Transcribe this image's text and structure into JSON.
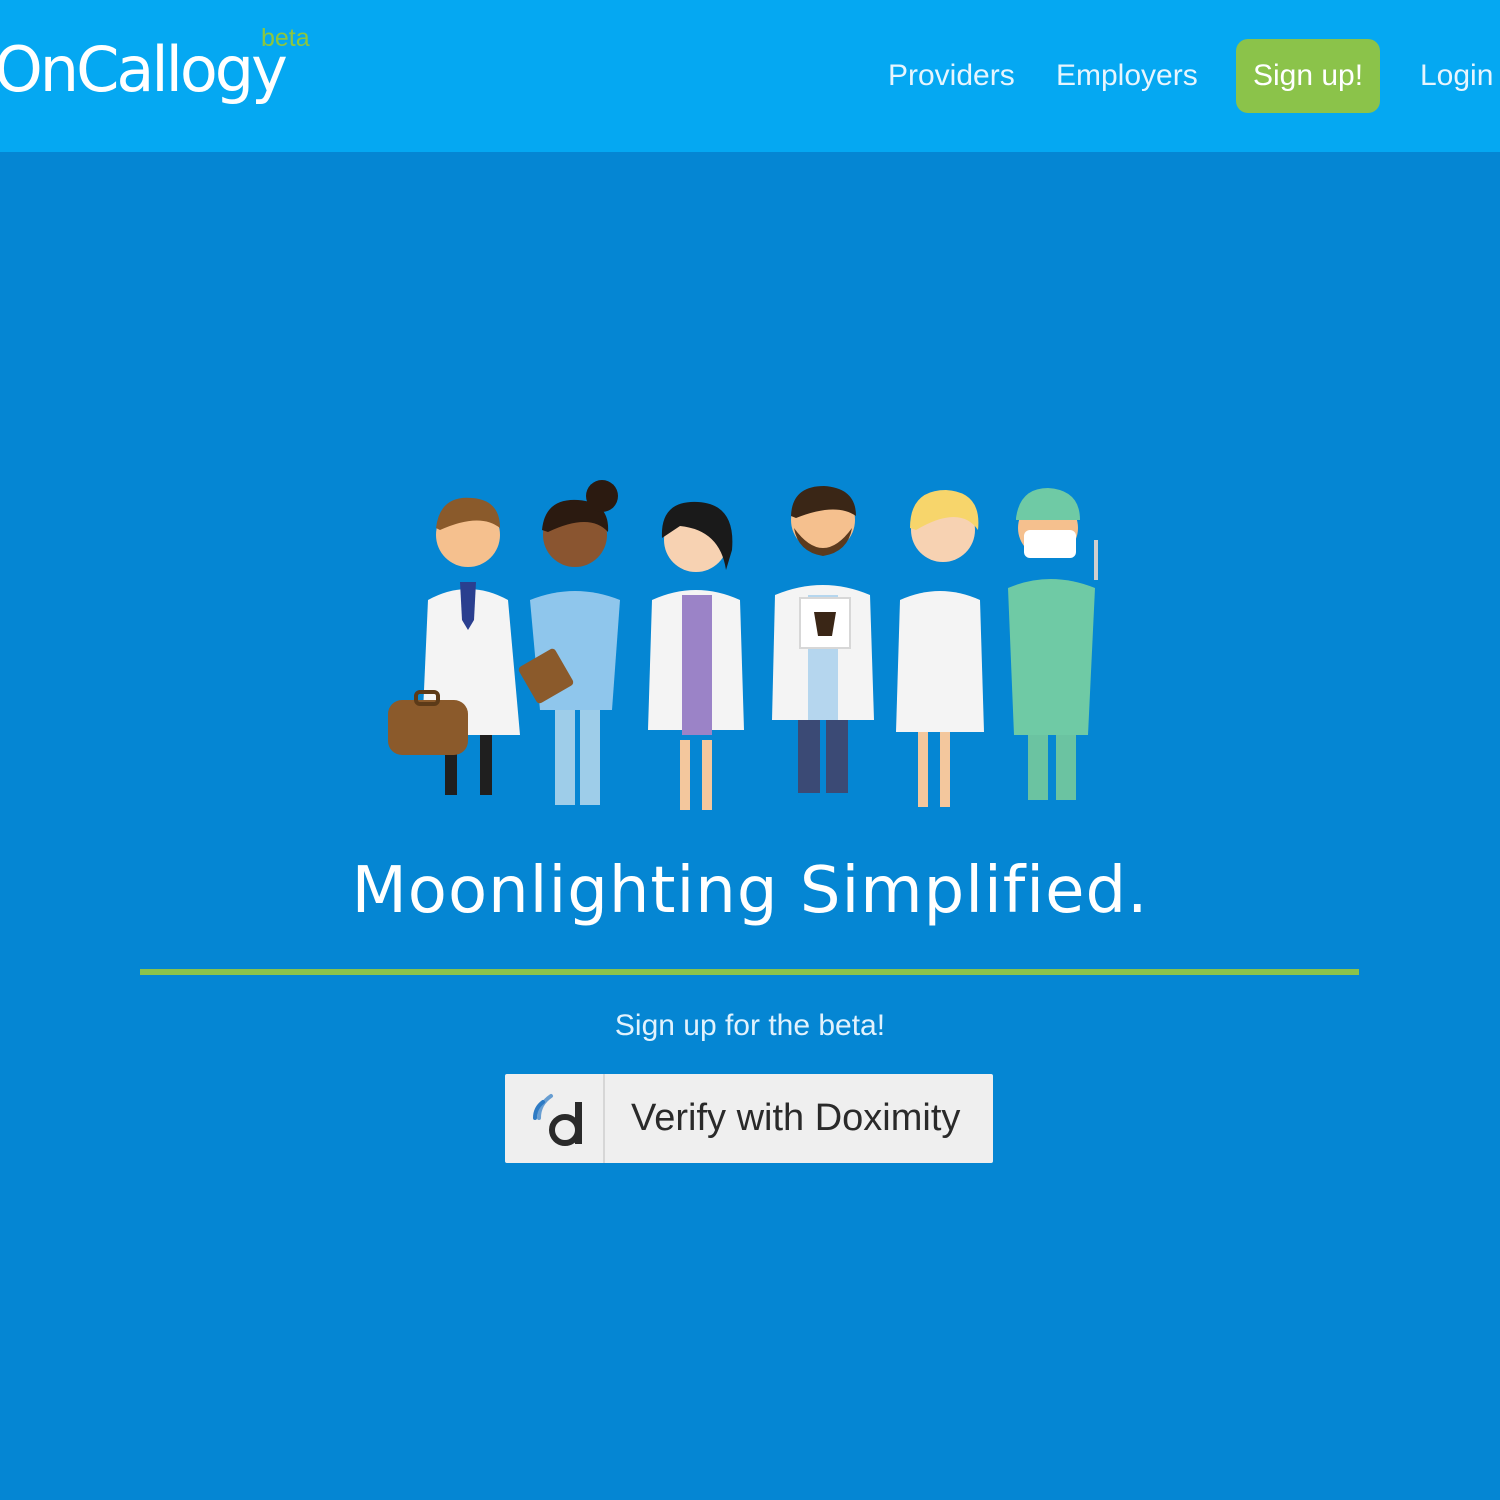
{
  "brand": {
    "logo_text": "OnCallogy",
    "beta_tag": "beta",
    "beta_color": "#8CC63F"
  },
  "nav": {
    "providers": "Providers",
    "employers": "Employers",
    "signup": "Sign up!",
    "login": "Login"
  },
  "hero": {
    "headline": "Moonlighting Simplified.",
    "subheading": "Sign up for the beta!",
    "verify_button": "Verify with Doximity",
    "illustration": "group-of-medical-professionals"
  },
  "colors": {
    "nav_background": "#05A8F2",
    "page_background": "#0586D3",
    "accent_green": "#8BC34A",
    "doximity_blue": "#2E7BC4"
  },
  "icons": {
    "doximity": "doximity-icon"
  }
}
